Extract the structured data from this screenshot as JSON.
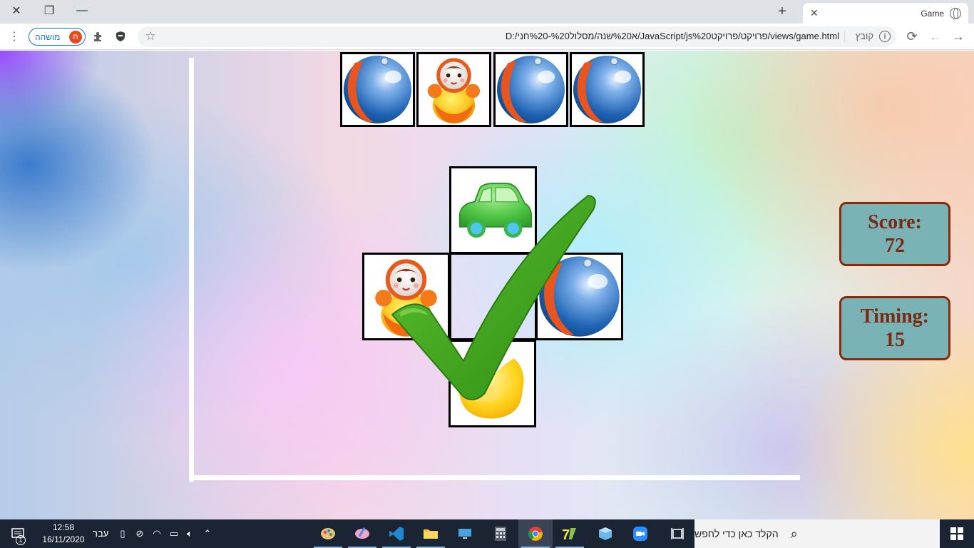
{
  "browser": {
    "tab_title": "Game",
    "url": "D:/א%20שנה/מסלול%20-%20חני/JavaScript/js%20פרויקט/פרויקט/views/game.html",
    "file_label": "קובץ",
    "profile_name": "מושהה",
    "profile_initial": "ח",
    "new_tab": "+",
    "tab_close": "✕"
  },
  "game": {
    "target_row": [
      "ball",
      "doll",
      "ball",
      "ball"
    ],
    "cross": {
      "top": "car",
      "left": "doll",
      "center": "empty",
      "right": "ball",
      "bottom": "duck"
    },
    "feedback_icon": "checkmark-icon",
    "score_label": "Score:",
    "score_value": "72",
    "timing_label": "Timing:",
    "timing_value": "15"
  },
  "taskbar": {
    "search_placeholder": "הקלד כאן כדי לחפש",
    "time": "12:58",
    "date": "16/11/2020",
    "language": "עבר",
    "notification_count": "1"
  },
  "colors": {
    "panel_bg": "#7ab3b5",
    "panel_border": "#8b2a0a",
    "panel_text": "#7a2a12",
    "check_green": "#3aa21a"
  }
}
